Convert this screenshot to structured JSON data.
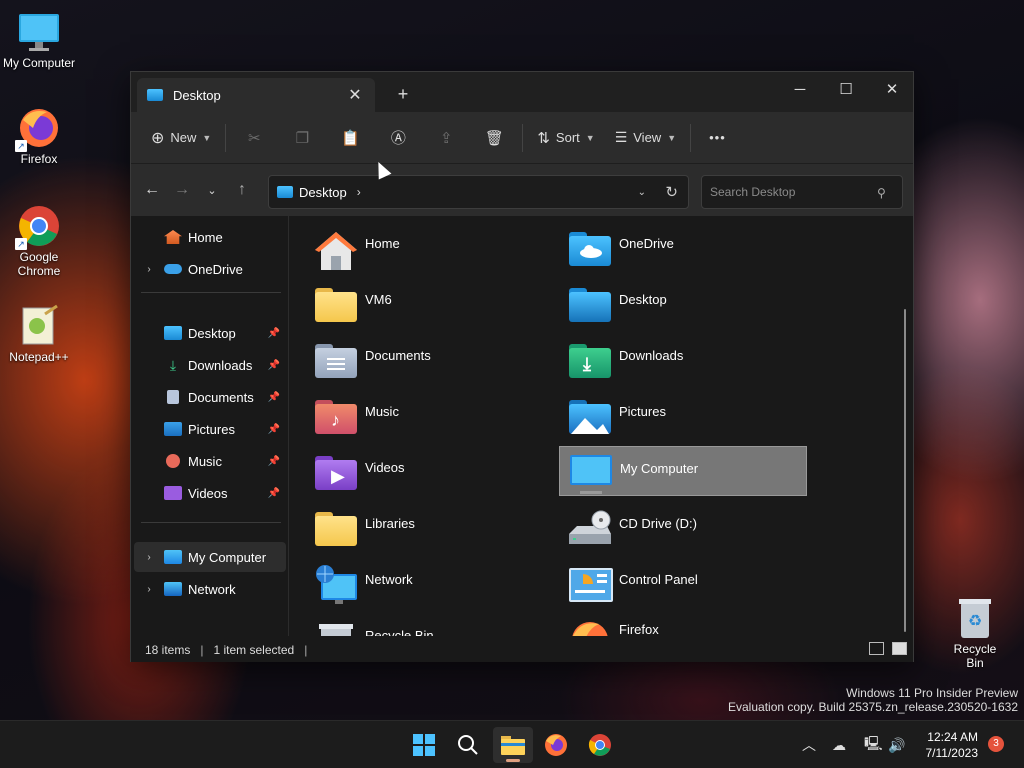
{
  "desktop": {
    "icons": [
      {
        "label": "My Computer",
        "icon": "monitor-icon"
      },
      {
        "label": "Firefox",
        "icon": "firefox-icon"
      },
      {
        "label": "Google Chrome",
        "icon": "chrome-icon"
      },
      {
        "label": "Notepad++",
        "icon": "notepadpp-icon"
      }
    ],
    "recycle_bin": {
      "label": "Recycle Bin",
      "icon": "recycle-bin-icon"
    }
  },
  "window": {
    "tab": {
      "title": "Desktop",
      "close_glyph": "✕"
    },
    "new_tab_glyph": "+",
    "controls": {
      "minimize": "─",
      "maximize": "☐",
      "close": "✕"
    }
  },
  "toolbar": {
    "new_label": "New",
    "sort_label": "Sort",
    "view_label": "View",
    "more_glyph": "•••",
    "icons": [
      "cut-icon",
      "copy-icon",
      "paste-icon",
      "rename-icon",
      "share-icon",
      "delete-icon"
    ]
  },
  "addressbar": {
    "path": "Desktop",
    "separator": "›",
    "search_placeholder": "Search Desktop"
  },
  "sidebar": {
    "items": [
      {
        "label": "Home",
        "icon": "home-icon"
      },
      {
        "label": "OneDrive",
        "icon": "onedrive-icon"
      },
      {
        "label": "Desktop",
        "icon": "desktop-folder-icon",
        "pinned": true
      },
      {
        "label": "Downloads",
        "icon": "downloads-icon",
        "pinned": true
      },
      {
        "label": "Documents",
        "icon": "documents-icon",
        "pinned": true
      },
      {
        "label": "Pictures",
        "icon": "pictures-icon",
        "pinned": true
      },
      {
        "label": "Music",
        "icon": "music-icon",
        "pinned": true
      },
      {
        "label": "Videos",
        "icon": "videos-icon",
        "pinned": true
      },
      {
        "label": "My Computer",
        "icon": "computer-icon",
        "selected": true
      },
      {
        "label": "Network",
        "icon": "network-icon"
      }
    ]
  },
  "content": {
    "items": [
      {
        "label": "Home",
        "icon": "home-icon"
      },
      {
        "label": "OneDrive",
        "icon": "onedrive-folder-icon"
      },
      {
        "label": "VM6",
        "icon": "folder-icon"
      },
      {
        "label": "Desktop",
        "icon": "desktop-folder-icon"
      },
      {
        "label": "Documents",
        "icon": "documents-folder-icon"
      },
      {
        "label": "Downloads",
        "icon": "downloads-folder-icon"
      },
      {
        "label": "Music",
        "icon": "music-folder-icon"
      },
      {
        "label": "Pictures",
        "icon": "pictures-folder-icon"
      },
      {
        "label": "Videos",
        "icon": "videos-folder-icon"
      },
      {
        "label": "My Computer",
        "icon": "computer-icon",
        "selected": true
      },
      {
        "label": "Libraries",
        "icon": "libraries-folder-icon"
      },
      {
        "label": "CD Drive (D:)",
        "icon": "cd-drive-icon"
      },
      {
        "label": "Network",
        "icon": "network-icon"
      },
      {
        "label": "Control Panel",
        "icon": "control-panel-icon"
      },
      {
        "label": "Recycle Bin",
        "icon": "recycle-bin-icon"
      },
      {
        "label": "Firefox",
        "icon": "firefox-icon"
      }
    ]
  },
  "status": {
    "item_count": "18 items",
    "selection": "1 item selected",
    "separator": "|"
  },
  "watermark": {
    "line1": "Windows 11 Pro Insider Preview",
    "line2": "Evaluation copy. Build 25375.zn_release.230520-1632"
  },
  "taskbar": {
    "apps": [
      "start-icon",
      "search-icon",
      "file-explorer-icon",
      "firefox-icon",
      "chrome-icon"
    ],
    "time": "12:24 AM",
    "date": "7/11/2023",
    "notifications": "3"
  }
}
